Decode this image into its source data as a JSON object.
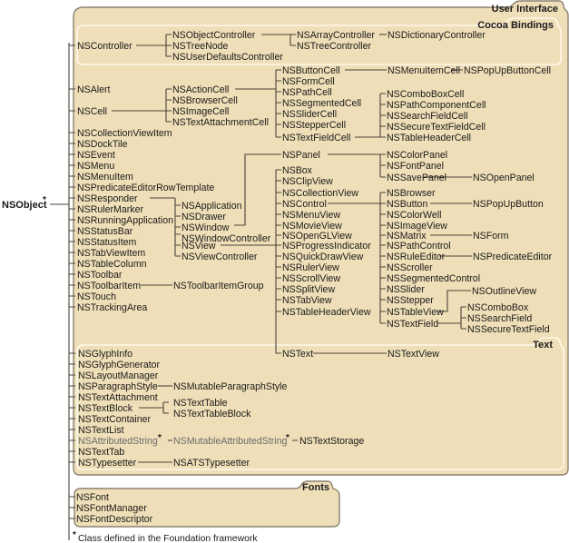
{
  "root": {
    "label": "NSObject",
    "marker": "*"
  },
  "groups": {
    "user_interface": "User Interface",
    "cocoa_bindings": "Cocoa Bindings",
    "text": "Text",
    "fonts": "Fonts"
  },
  "footnote": {
    "marker": "*",
    "text": "Class defined in the Foundation framework"
  },
  "classes": {
    "NSController": "NSController",
    "NSObjectController": "NSObjectController",
    "NSTreeNode": "NSTreeNode",
    "NSUserDefaultsController": "NSUserDefaultsController",
    "NSArrayController": "NSArrayController",
    "NSTreeController": "NSTreeController",
    "NSDictionaryController": "NSDictionaryController",
    "NSAlert": "NSAlert",
    "NSCell": "NSCell",
    "NSActionCell": "NSActionCell",
    "NSBrowserCell": "NSBrowserCell",
    "NSImageCell": "NSImageCell",
    "NSTextAttachmentCell": "NSTextAttachmentCell",
    "NSButtonCell": "NSButtonCell",
    "NSFormCell": "NSFormCell",
    "NSPathCell": "NSPathCell",
    "NSSegmentedCell": "NSSegmentedCell",
    "NSSliderCell": "NSSliderCell",
    "NSStepperCell": "NSStepperCell",
    "NSTextFieldCell": "NSTextFieldCell",
    "NSMenuItemCell": "NSMenuItemCell",
    "NSPopUpButtonCell": "NSPopUpButtonCell",
    "NSComboBoxCell": "NSComboBoxCell",
    "NSPathComponentCell": "NSPathComponentCell",
    "NSSearchFieldCell": "NSSearchFieldCell",
    "NSSecureTextFieldCell": "NSSecureTextFieldCell",
    "NSTableHeaderCell": "NSTableHeaderCell",
    "NSCollectionViewItem": "NSCollectionViewItem",
    "NSDockTile": "NSDockTile",
    "NSEvent": "NSEvent",
    "NSMenu": "NSMenu",
    "NSMenuItem": "NSMenuItem",
    "NSPredicateEditorRowTemplate": "NSPredicateEditorRowTemplate",
    "NSResponder": "NSResponder",
    "NSRulerMarker": "NSRulerMarker",
    "NSRunningApplication": "NSRunningApplication",
    "NSStatusBar": "NSStatusBar",
    "NSStatusItem": "NSStatusItem",
    "NSTabViewItem": "NSTabViewItem",
    "NSTableColumn": "NSTableColumn",
    "NSToolbar": "NSToolbar",
    "NSToolbarItem": "NSToolbarItem",
    "NSTouch": "NSTouch",
    "NSTrackingArea": "NSTrackingArea",
    "NSApplication": "NSApplication",
    "NSDrawer": "NSDrawer",
    "NSWindow": "NSWindow",
    "NSWindowController": "NSWindowController",
    "NSView": "NSView",
    "NSViewController": "NSViewController",
    "NSToolbarItemGroup": "NSToolbarItemGroup",
    "NSPanel": "NSPanel",
    "NSColorPanel": "NSColorPanel",
    "NSFontPanel": "NSFontPanel",
    "NSSavePanel": "NSSavePanel",
    "NSOpenPanel": "NSOpenPanel",
    "NSBox": "NSBox",
    "NSClipView": "NSClipView",
    "NSCollectionView": "NSCollectionView",
    "NSControl": "NSControl",
    "NSMenuView": "NSMenuView",
    "NSMovieView": "NSMovieView",
    "NSOpenGLView": "NSOpenGLView",
    "NSProgressIndicator": "NSProgressIndicator",
    "NSQuickDrawView": "NSQuickDrawView",
    "NSRulerView": "NSRulerView",
    "NSScrollView": "NSScrollView",
    "NSSplitView": "NSSplitView",
    "NSTabView": "NSTabView",
    "NSTableHeaderView": "NSTableHeaderView",
    "NSText": "NSText",
    "NSTextView": "NSTextView",
    "NSBrowser": "NSBrowser",
    "NSButton": "NSButton",
    "NSColorWell": "NSColorWell",
    "NSImageView": "NSImageView",
    "NSMatrix": "NSMatrix",
    "NSPathControl": "NSPathControl",
    "NSRuleEditor": "NSRuleEditor",
    "NSScroller": "NSScroller",
    "NSSegmentedControl": "NSSegmentedControl",
    "NSSlider": "NSSlider",
    "NSStepper": "NSStepper",
    "NSTableView": "NSTableView",
    "NSTextField": "NSTextField",
    "NSPopUpButton": "NSPopUpButton",
    "NSForm": "NSForm",
    "NSPredicateEditor": "NSPredicateEditor",
    "NSOutlineView": "NSOutlineView",
    "NSComboBox": "NSComboBox",
    "NSSearchField": "NSSearchField",
    "NSSecureTextField": "NSSecureTextField",
    "NSGlyphInfo": "NSGlyphInfo",
    "NSGlyphGenerator": "NSGlyphGenerator",
    "NSLayoutManager": "NSLayoutManager",
    "NSParagraphStyle": "NSParagraphStyle",
    "NSMutableParagraphStyle": "NSMutableParagraphStyle",
    "NSTextAttachment": "NSTextAttachment",
    "NSTextBlock": "NSTextBlock",
    "NSTextTable": "NSTextTable",
    "NSTextTableBlock": "NSTextTableBlock",
    "NSTextContainer": "NSTextContainer",
    "NSTextList": "NSTextList",
    "NSAttributedString": "NSAttributedString",
    "NSMutableAttributedString": "NSMutableAttributedString",
    "NSTextStorage": "NSTextStorage",
    "NSTextTab": "NSTextTab",
    "NSTypesetter": "NSTypesetter",
    "NSATSTypesetter": "NSATSTypesetter",
    "NSFont": "NSFont",
    "NSFontManager": "NSFontManager",
    "NSFontDescriptor": "NSFontDescriptor"
  },
  "foundation_marker": "*"
}
